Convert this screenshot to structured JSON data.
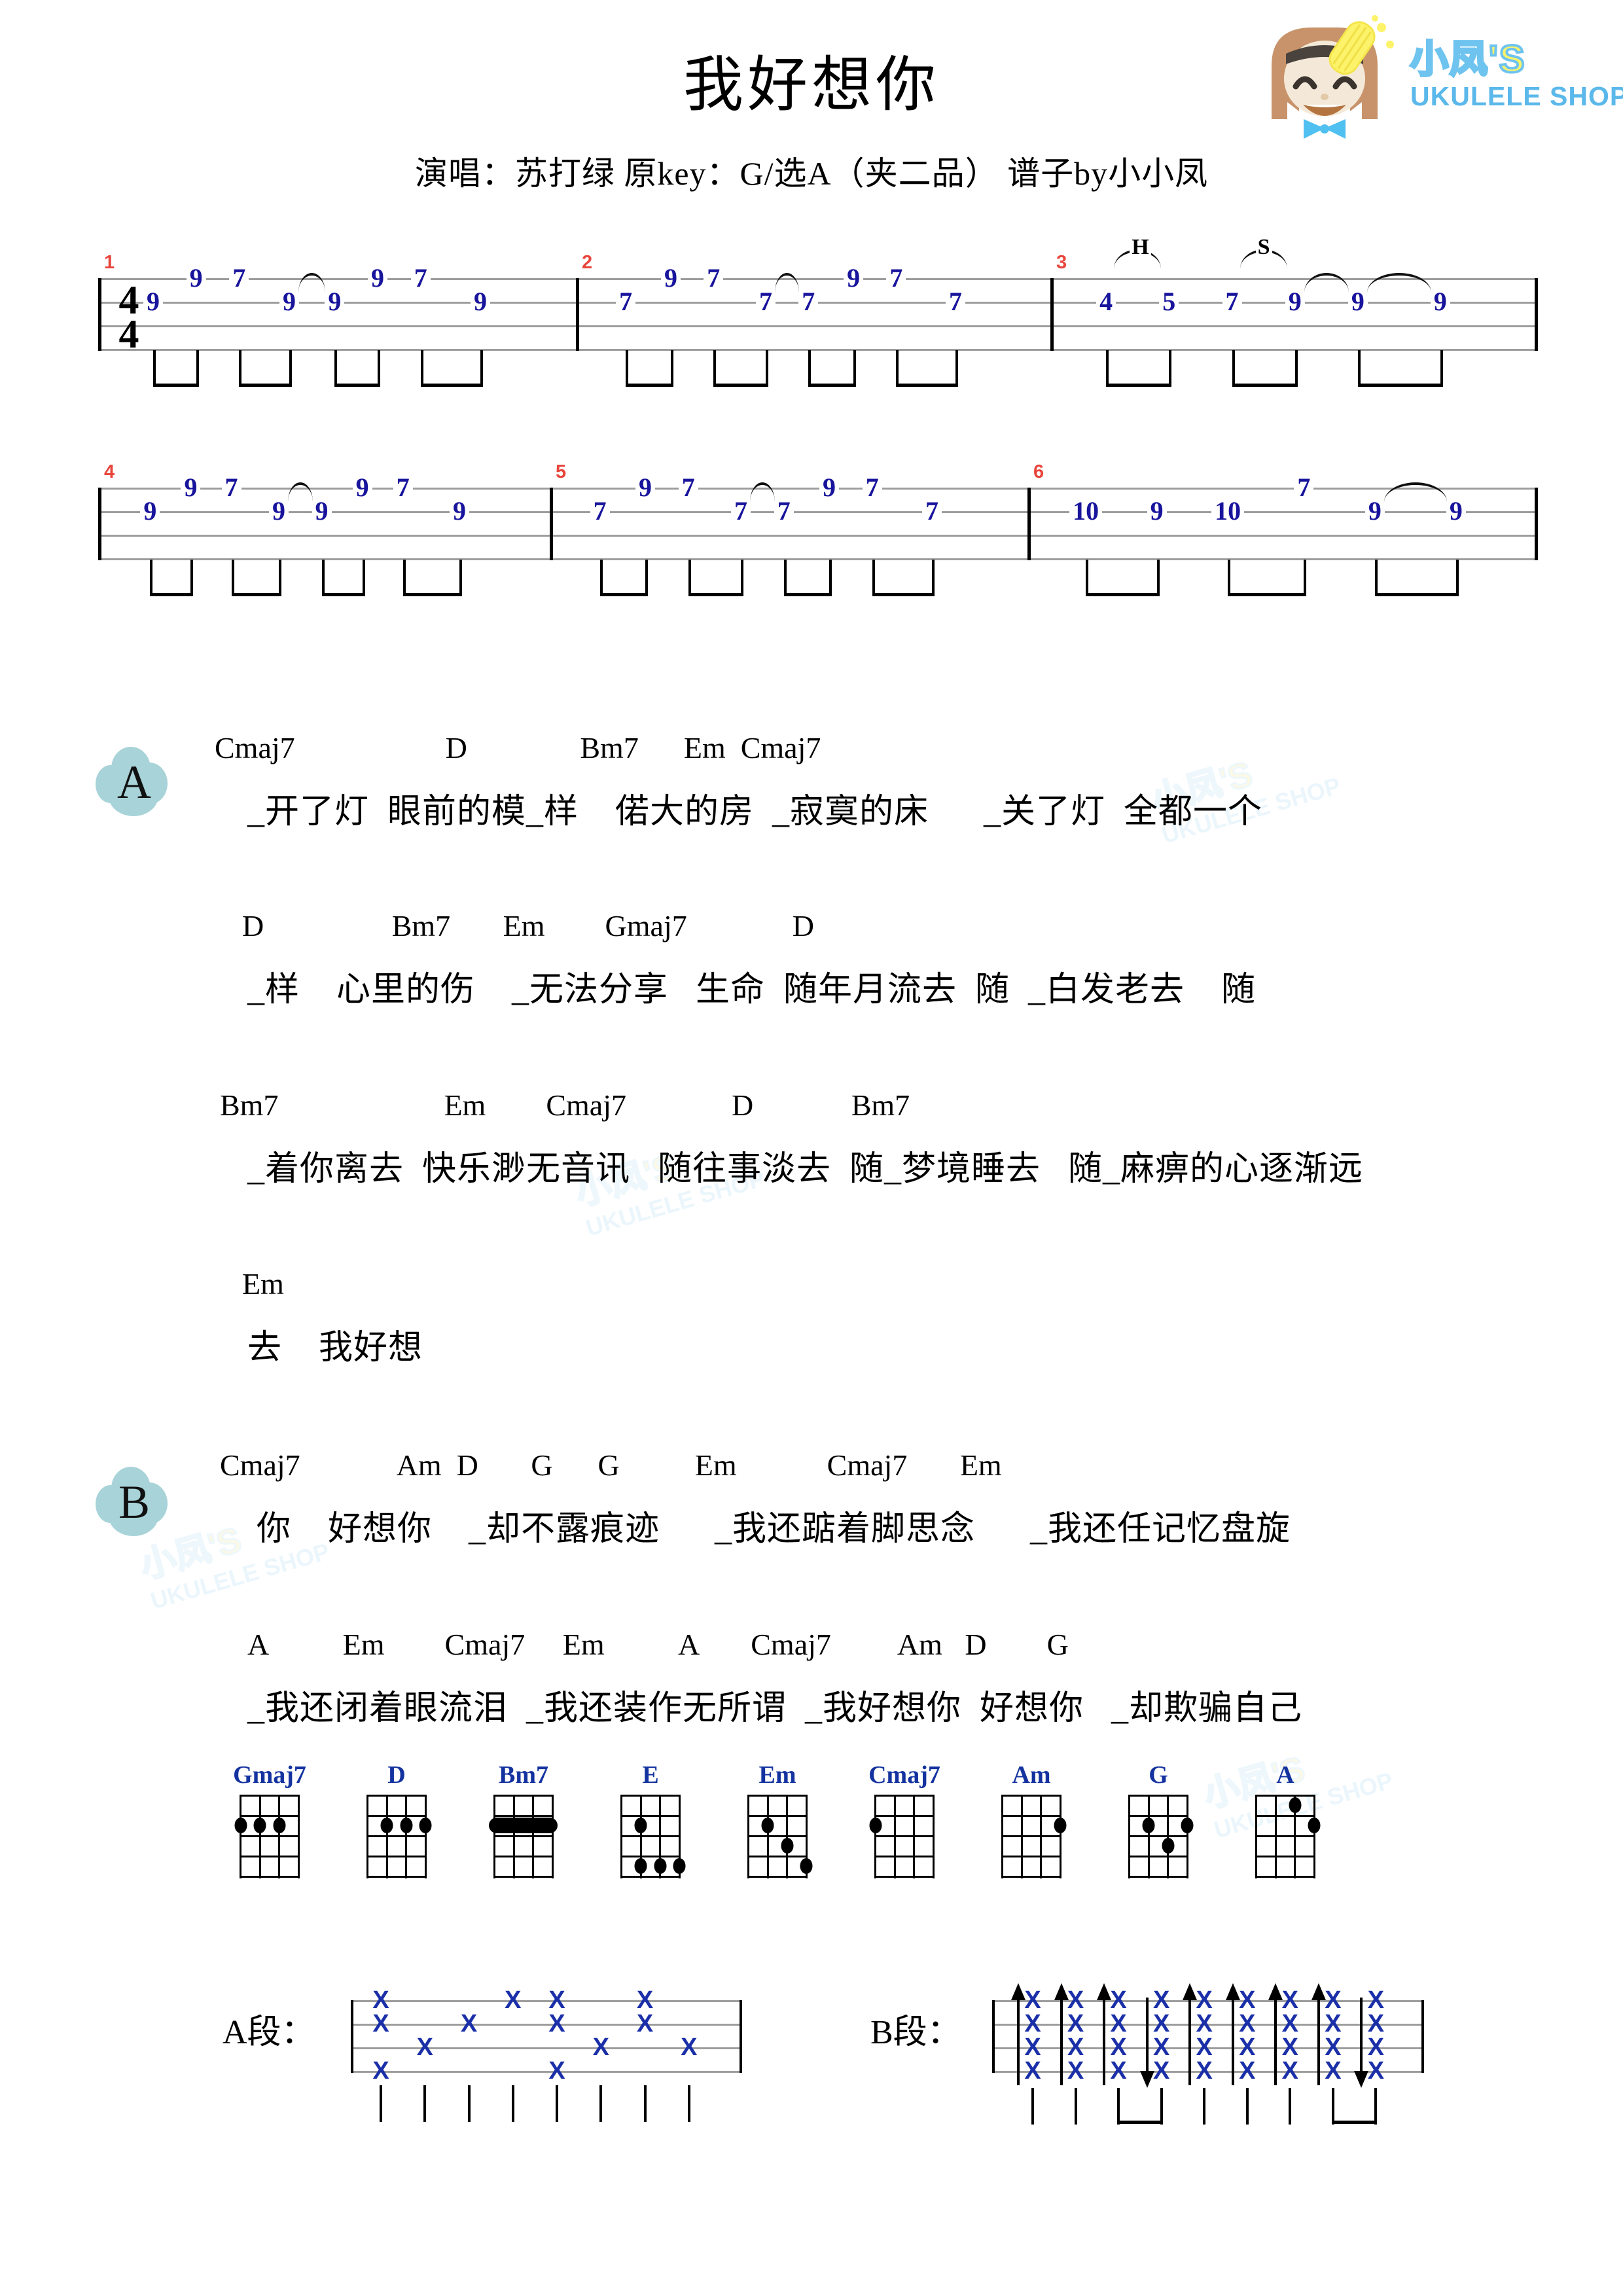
{
  "header": {
    "title": "我好想你",
    "subtitle": "演唱：苏打绿    原key：G/选A（夹二品）  谱子by小小凤"
  },
  "logo": {
    "cn": "小凤'S",
    "en": "UKULELE SHOP",
    "colors": {
      "yellow": "#fdf36a",
      "blue": "#5bb8ea",
      "hair": "#c8936a",
      "bow": "#4fc0f0"
    }
  },
  "tab": {
    "time_signature": "4/4",
    "measures": [
      {
        "number": "1",
        "notes": [
          {
            "string": 2,
            "fret": "9",
            "x": 0.115
          },
          {
            "string": 1,
            "fret": "9",
            "x": 0.205
          },
          {
            "string": 1,
            "fret": "7",
            "x": 0.295
          },
          {
            "string": 2,
            "fret": "9",
            "x": 0.4
          },
          {
            "string": 2,
            "fret": "9",
            "x": 0.495
          },
          {
            "string": 1,
            "fret": "9",
            "x": 0.585
          },
          {
            "string": 1,
            "fret": "7",
            "x": 0.675
          },
          {
            "string": 2,
            "fret": "9",
            "x": 0.8
          }
        ],
        "ties": [
          {
            "from": 0.4,
            "to": 0.495,
            "string": 1
          }
        ]
      },
      {
        "number": "2",
        "notes": [
          {
            "string": 2,
            "fret": "7",
            "x": 0.105
          },
          {
            "string": 1,
            "fret": "9",
            "x": 0.2
          },
          {
            "string": 1,
            "fret": "7",
            "x": 0.29
          },
          {
            "string": 2,
            "fret": "7",
            "x": 0.4
          },
          {
            "string": 2,
            "fret": "7",
            "x": 0.49
          },
          {
            "string": 1,
            "fret": "9",
            "x": 0.585
          },
          {
            "string": 1,
            "fret": "7",
            "x": 0.675
          },
          {
            "string": 2,
            "fret": "7",
            "x": 0.8
          }
        ],
        "ties": [
          {
            "from": 0.4,
            "to": 0.49,
            "string": 1
          }
        ]
      },
      {
        "number": "3",
        "notes": [
          {
            "string": 2,
            "fret": "4",
            "x": 0.115
          },
          {
            "string": 2,
            "fret": "5",
            "x": 0.245
          },
          {
            "string": 2,
            "fret": "7",
            "x": 0.375
          },
          {
            "string": 2,
            "fret": "9",
            "x": 0.505
          },
          {
            "string": 2,
            "fret": "9",
            "x": 0.635
          },
          {
            "string": 2,
            "fret": "9",
            "x": 0.805
          }
        ],
        "ties": [
          {
            "from": 0.505,
            "to": 0.635,
            "string": 1
          },
          {
            "from": 0.635,
            "to": 0.805,
            "string": 1
          }
        ],
        "articulations": [
          {
            "symbol": "H",
            "from": 0.115,
            "to": 0.245
          },
          {
            "symbol": "S",
            "from": 0.375,
            "to": 0.505
          }
        ]
      },
      {
        "number": "4",
        "notes": [
          {
            "string": 2,
            "fret": "9",
            "x": 0.115
          },
          {
            "string": 1,
            "fret": "9",
            "x": 0.205
          },
          {
            "string": 1,
            "fret": "7",
            "x": 0.295
          },
          {
            "string": 2,
            "fret": "9",
            "x": 0.4
          },
          {
            "string": 2,
            "fret": "9",
            "x": 0.495
          },
          {
            "string": 1,
            "fret": "9",
            "x": 0.585
          },
          {
            "string": 1,
            "fret": "7",
            "x": 0.675
          },
          {
            "string": 2,
            "fret": "9",
            "x": 0.8
          }
        ],
        "ties": [
          {
            "from": 0.4,
            "to": 0.495,
            "string": 1
          }
        ]
      },
      {
        "number": "5",
        "notes": [
          {
            "string": 2,
            "fret": "7",
            "x": 0.105
          },
          {
            "string": 1,
            "fret": "9",
            "x": 0.2
          },
          {
            "string": 1,
            "fret": "7",
            "x": 0.29
          },
          {
            "string": 2,
            "fret": "7",
            "x": 0.4
          },
          {
            "string": 2,
            "fret": "7",
            "x": 0.49
          },
          {
            "string": 1,
            "fret": "9",
            "x": 0.585
          },
          {
            "string": 1,
            "fret": "7",
            "x": 0.675
          },
          {
            "string": 2,
            "fret": "7",
            "x": 0.8
          }
        ],
        "ties": [
          {
            "from": 0.4,
            "to": 0.49,
            "string": 1
          }
        ]
      },
      {
        "number": "6",
        "notes": [
          {
            "string": 2,
            "fret": "10",
            "x": 0.115
          },
          {
            "string": 2,
            "fret": "9",
            "x": 0.255
          },
          {
            "string": 2,
            "fret": "10",
            "x": 0.395
          },
          {
            "string": 1,
            "fret": "7",
            "x": 0.545
          },
          {
            "string": 2,
            "fret": "9",
            "x": 0.685
          },
          {
            "string": 2,
            "fret": "9",
            "x": 0.845
          }
        ],
        "ties": [
          {
            "from": 0.685,
            "to": 0.845,
            "string": 1
          }
        ]
      }
    ]
  },
  "sections": [
    {
      "badge": "A",
      "lines": [
        {
          "chords": "Cmaj7                    D               Bm7      Em  Cmaj7",
          "lyrics": "_开了灯  眼前的模_样    偌大的房  _寂寞的床      _关了灯  全都一个"
        },
        {
          "chords": "D                 Bm7       Em        Gmaj7              D",
          "lyrics": "_样    心里的伤    _无法分享   生命  随年月流去  随  _白发老去    随"
        },
        {
          "chords": "Bm7                      Em        Cmaj7              D             Bm7",
          "lyrics": "_着你离去  快乐渺无音讯   随往事淡去  随_梦境睡去   随_麻痹的心逐渐远"
        },
        {
          "chords": "Em",
          "lyrics": "去    我好想"
        }
      ]
    },
    {
      "badge": "B",
      "lines": [
        {
          "chords": "Cmaj7             Am  D       G      G          Em            Cmaj7       Em",
          "lyrics": "你    好想你    _却不露痕迹      _我还踮着脚思念      _我还任记忆盘旋"
        },
        {
          "chords": "A          Em        Cmaj7     Em          A       Cmaj7         Am   D        G",
          "lyrics": "_我还闭着眼流泪  _我还装作无所谓  _我好想你  好想你   _却欺骗自己"
        }
      ]
    }
  ],
  "chord_diagrams": [
    {
      "name": "Gmaj7",
      "dots": [
        {
          "s": 1,
          "f": 2
        },
        {
          "s": 2,
          "f": 2
        },
        {
          "s": 3,
          "f": 2
        }
      ],
      "barre": null
    },
    {
      "name": "D",
      "dots": [
        {
          "s": 2,
          "f": 2
        },
        {
          "s": 3,
          "f": 2
        },
        {
          "s": 4,
          "f": 2
        }
      ],
      "barre": null
    },
    {
      "name": "Bm7",
      "dots": [],
      "barre": {
        "fret": 2,
        "from": 1,
        "to": 4
      }
    },
    {
      "name": "E",
      "dots": [
        {
          "s": 2,
          "f": 2
        },
        {
          "s": 2,
          "f": 4
        },
        {
          "s": 3,
          "f": 4
        },
        {
          "s": 4,
          "f": 4
        }
      ],
      "barre": null
    },
    {
      "name": "Em",
      "dots": [
        {
          "s": 2,
          "f": 2
        },
        {
          "s": 3,
          "f": 3
        },
        {
          "s": 4,
          "f": 4
        }
      ],
      "barre": null
    },
    {
      "name": "Cmaj7",
      "dots": [
        {
          "s": 1,
          "f": 2
        }
      ],
      "barre": null
    },
    {
      "name": "Am",
      "dots": [
        {
          "s": 4,
          "f": 2
        }
      ],
      "barre": null
    },
    {
      "name": "G",
      "dots": [
        {
          "s": 2,
          "f": 2
        },
        {
          "s": 3,
          "f": 3
        },
        {
          "s": 4,
          "f": 2
        }
      ],
      "barre": null
    },
    {
      "name": "A",
      "dots": [
        {
          "s": 3,
          "f": 1
        },
        {
          "s": 4,
          "f": 2
        }
      ],
      "barre": null
    }
  ],
  "strum": {
    "section_a": {
      "label": "A段：",
      "pattern_type": "fingerpick",
      "marks": [
        {
          "beat": 0,
          "strings": [
            1,
            2,
            4
          ]
        },
        {
          "beat": 1,
          "strings": [
            3
          ]
        },
        {
          "beat": 2,
          "strings": [
            2
          ]
        },
        {
          "beat": 3,
          "strings": [
            1
          ]
        },
        {
          "beat": 4,
          "strings": [
            1,
            2,
            4
          ]
        },
        {
          "beat": 5,
          "strings": [
            3
          ]
        },
        {
          "beat": 6,
          "strings": [
            1,
            2
          ]
        },
        {
          "beat": 7,
          "strings": [
            3
          ]
        }
      ]
    },
    "section_b": {
      "label": "B段：",
      "pattern_type": "strum",
      "strokes": [
        "up",
        "up",
        "up",
        "down",
        "up",
        "up",
        "up",
        "up",
        "down"
      ]
    }
  },
  "watermark": {
    "cn": "小凤'S",
    "en": "UKULELE SHOP"
  }
}
